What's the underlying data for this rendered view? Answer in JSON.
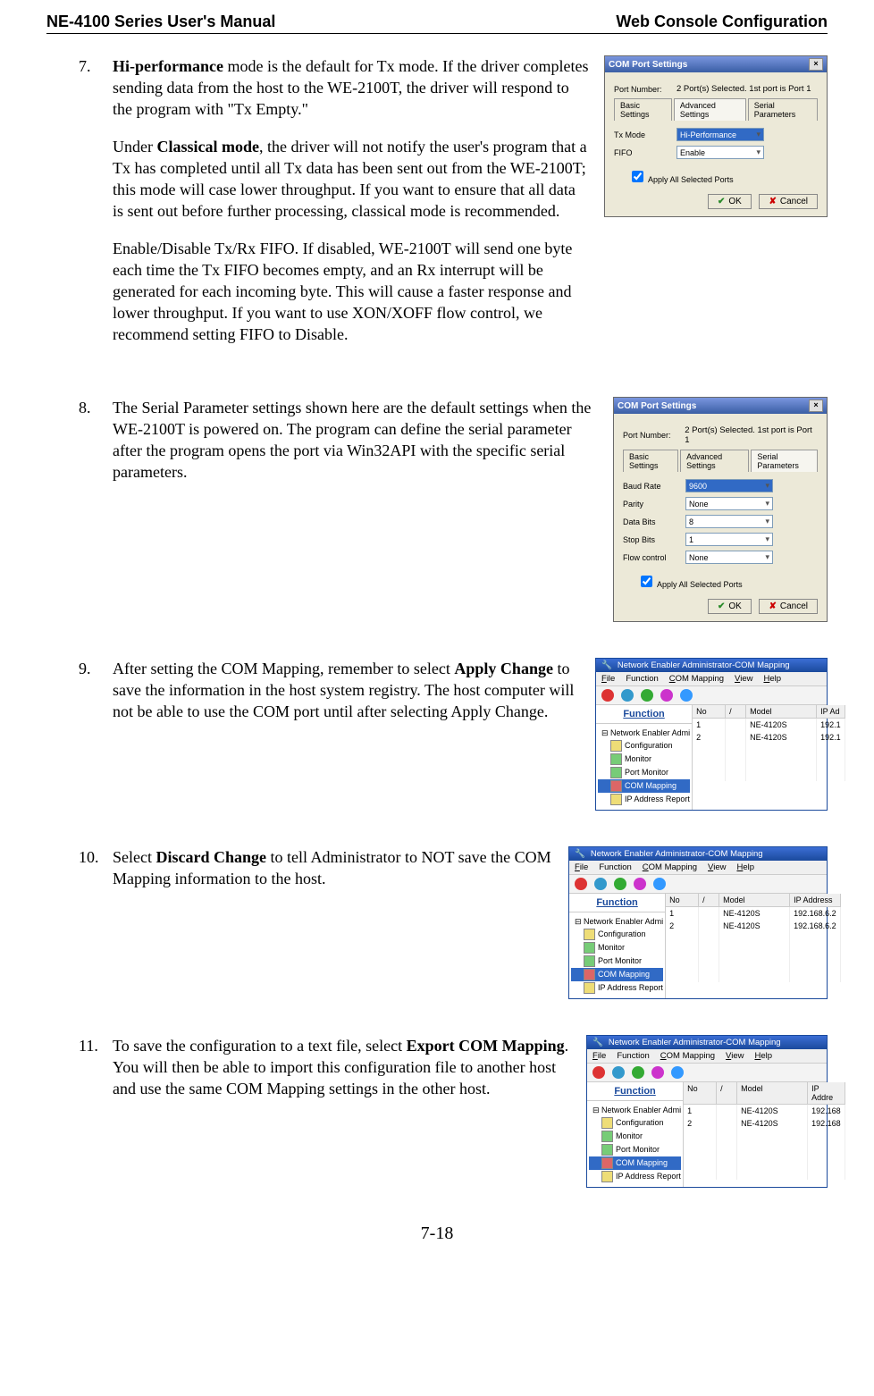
{
  "header": {
    "left": "NE-4100 Series User's Manual",
    "right": "Web Console Configuration"
  },
  "items": [
    {
      "num": "7.",
      "paras": [
        [
          {
            "b": true,
            "t": "Hi-performance"
          },
          {
            "b": false,
            "t": " mode is the default for Tx mode. If the driver completes sending data from the host to the WE-2100T, the driver will respond to the program with \"Tx Empty.\""
          }
        ],
        [
          {
            "b": false,
            "t": "Under "
          },
          {
            "b": true,
            "t": "Classical mode"
          },
          {
            "b": false,
            "t": ", the driver will not notify the user's program that a Tx has completed until all Tx data has been sent out from the WE-2100T; this mode will case lower throughput. If you want to ensure that all data is sent out before further processing, classical mode is recommended."
          }
        ],
        [
          {
            "b": false,
            "t": "Enable/Disable Tx/Rx FIFO. If disabled, WE-2100T will send one byte each time the Tx FIFO becomes empty, and an Rx interrupt will be generated for each incoming byte. This will cause a faster response and lower throughput. If you want to use XON/XOFF flow control, we recommend setting FIFO to Disable."
          }
        ]
      ]
    },
    {
      "num": "8.",
      "paras": [
        [
          {
            "b": false,
            "t": "The Serial Parameter settings shown here are the default settings when the WE-2100T is powered on. The program can define the serial parameter after the program opens the port via Win32API with the specific serial parameters."
          }
        ]
      ]
    },
    {
      "num": "9.",
      "paras": [
        [
          {
            "b": false,
            "t": "After setting the COM Mapping, remember to select "
          },
          {
            "b": true,
            "t": "Apply Change"
          },
          {
            "b": false,
            "t": " to save the information in the host system registry. The host computer will not be able to use the COM port until after selecting Apply Change."
          }
        ]
      ]
    },
    {
      "num": "10.",
      "paras": [
        [
          {
            "b": false,
            "t": "Select "
          },
          {
            "b": true,
            "t": "Discard Change"
          },
          {
            "b": false,
            "t": " to tell Administrator to NOT save the COM Mapping information to the host."
          }
        ]
      ]
    },
    {
      "num": "11.",
      "paras": [
        [
          {
            "b": false,
            "t": "To save the configuration to a text file, select "
          },
          {
            "b": true,
            "t": "Export COM Mapping"
          },
          {
            "b": false,
            "t": ". You will then be able to import this configuration file to another host and use the same COM Mapping settings in the other host."
          }
        ]
      ]
    }
  ],
  "dlg1": {
    "title": "COM Port Settings",
    "portLabel": "Port Number:",
    "portValue": "2 Port(s) Selected. 1st port is Port 1",
    "tabs": [
      "Basic Settings",
      "Advanced Settings",
      "Serial Parameters"
    ],
    "activeTab": 1,
    "rows": [
      {
        "lbl": "Tx Mode",
        "val": "Hi-Performance",
        "sel": true
      },
      {
        "lbl": "FIFO",
        "val": "Enable",
        "sel": false
      }
    ],
    "apply": "Apply All Selected Ports",
    "ok": "OK",
    "cancel": "Cancel"
  },
  "dlg2": {
    "title": "COM Port Settings",
    "portLabel": "Port Number:",
    "portValue": "2 Port(s) Selected. 1st port is Port 1",
    "tabs": [
      "Basic Settings",
      "Advanced Settings",
      "Serial Parameters"
    ],
    "activeTab": 2,
    "rows": [
      {
        "lbl": "Baud Rate",
        "val": "9600",
        "sel": true
      },
      {
        "lbl": "Parity",
        "val": "None",
        "sel": false
      },
      {
        "lbl": "Data Bits",
        "val": "8",
        "sel": false
      },
      {
        "lbl": "Stop Bits",
        "val": "1",
        "sel": false
      },
      {
        "lbl": "Flow control",
        "val": "None",
        "sel": false
      }
    ],
    "apply": "Apply All Selected Ports",
    "ok": "OK",
    "cancel": "Cancel"
  },
  "app": {
    "title": "Network Enabler Administrator-COM Mapping",
    "menus": [
      "File",
      "Function",
      "COM Mapping",
      "View",
      "Help"
    ],
    "funcHeader": "Function",
    "tree": [
      {
        "t": "Network Enabler Admi",
        "sel": false
      },
      {
        "t": "Configuration",
        "sel": false
      },
      {
        "t": "Monitor",
        "sel": false
      },
      {
        "t": "Port Monitor",
        "sel": false
      },
      {
        "t": "COM Mapping",
        "sel": true
      },
      {
        "t": "IP Address Report",
        "sel": false
      }
    ],
    "colsA": [
      "No",
      "/",
      "Model",
      "IP Ad"
    ],
    "rowsA": [
      {
        "no": "1",
        "model": "NE-4120S",
        "ip": "192.1"
      },
      {
        "no": "2",
        "model": "NE-4120S",
        "ip": "192.1"
      }
    ],
    "colsB": [
      "No",
      "/",
      "Model",
      "IP Address"
    ],
    "rowsB": [
      {
        "no": "1",
        "model": "NE-4120S",
        "ip": "192.168.6.2"
      },
      {
        "no": "2",
        "model": "NE-4120S",
        "ip": "192.168.6.2"
      }
    ],
    "colsC": [
      "No",
      "/",
      "Model",
      "IP Addre"
    ],
    "rowsC": [
      {
        "no": "1",
        "model": "NE-4120S",
        "ip": "192.168"
      },
      {
        "no": "2",
        "model": "NE-4120S",
        "ip": "192.168"
      }
    ]
  },
  "pageNum": "7-18"
}
